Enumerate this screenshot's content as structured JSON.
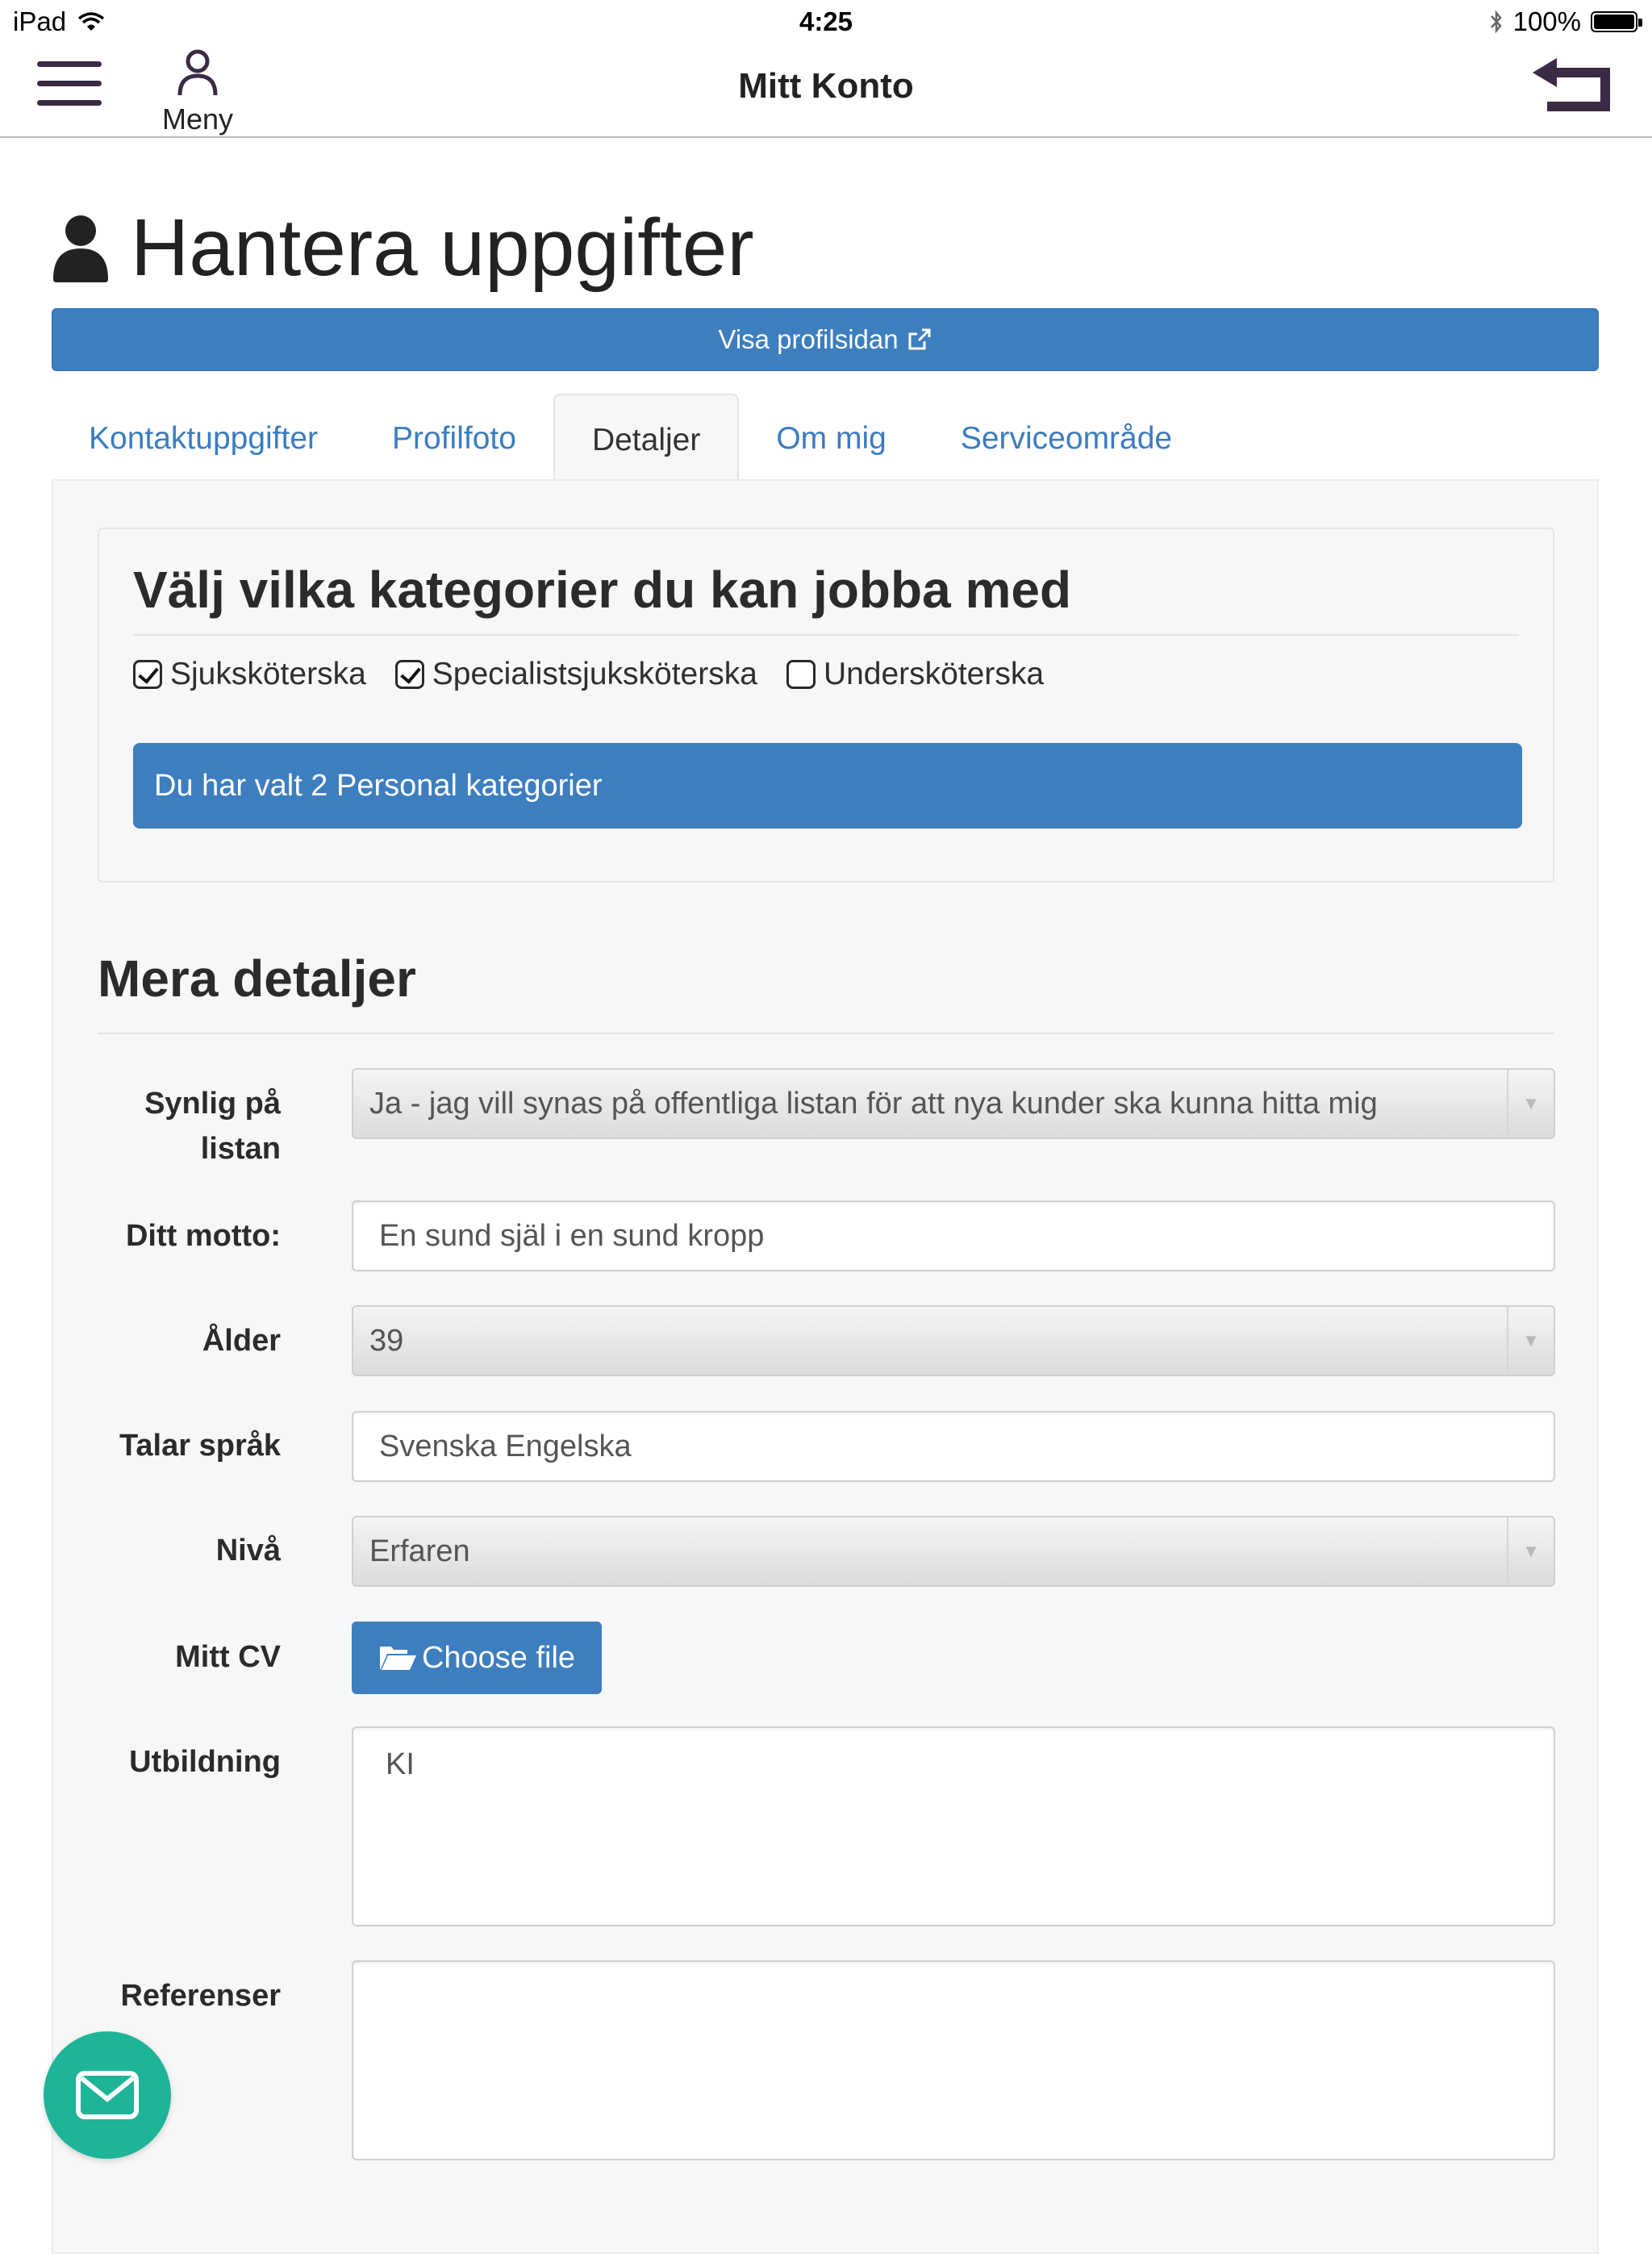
{
  "status_bar": {
    "device": "iPad",
    "time": "4:25",
    "battery": "100%"
  },
  "navbar": {
    "menu_label": "Meny",
    "title": "Mitt Konto"
  },
  "page": {
    "title": "Hantera uppgifter",
    "profile_link": "Visa profilsidan"
  },
  "tabs": [
    {
      "label": "Kontaktuppgifter",
      "active": false
    },
    {
      "label": "Profilfoto",
      "active": false
    },
    {
      "label": "Detaljer",
      "active": true
    },
    {
      "label": "Om mig",
      "active": false
    },
    {
      "label": "Serviceområde",
      "active": false
    }
  ],
  "categories": {
    "heading": "Välj vilka kategorier du kan jobba med",
    "options": [
      {
        "label": "Sjuksköterska",
        "checked": true
      },
      {
        "label": "Specialistsjuksköterska",
        "checked": true
      },
      {
        "label": "Undersköterska",
        "checked": false
      }
    ],
    "selected_text": "Du har valt 2 Personal kategorier"
  },
  "details": {
    "heading": "Mera detaljer",
    "visible_label_line1": "Synlig på",
    "visible_label_line2": "listan",
    "visible_value": "Ja - jag vill synas på offentliga listan för att nya kunder ska kunna hitta mig",
    "motto_label": "Ditt motto:",
    "motto_value": "En sund själ i en sund kropp",
    "age_label": "Ålder",
    "age_value": "39",
    "languages_label": "Talar språk",
    "languages_value": "Svenska Engelska",
    "level_label": "Nivå",
    "level_value": "Erfaren",
    "cv_label": "Mitt CV",
    "cv_button": "Choose file",
    "education_label": "Utbildning",
    "education_value": "KI",
    "references_label": "Referenser",
    "references_value": ""
  },
  "colors": {
    "primary": "#3d7ebf",
    "link": "#3b7cc0",
    "nav_icon": "#3b2a43",
    "fab": "#1eb497"
  },
  "icons": {
    "hamburger": "hamburger-icon",
    "user": "user-icon",
    "back": "back-arrow-icon",
    "external": "external-link-icon",
    "folder": "folder-open-icon",
    "mail": "mail-icon"
  }
}
